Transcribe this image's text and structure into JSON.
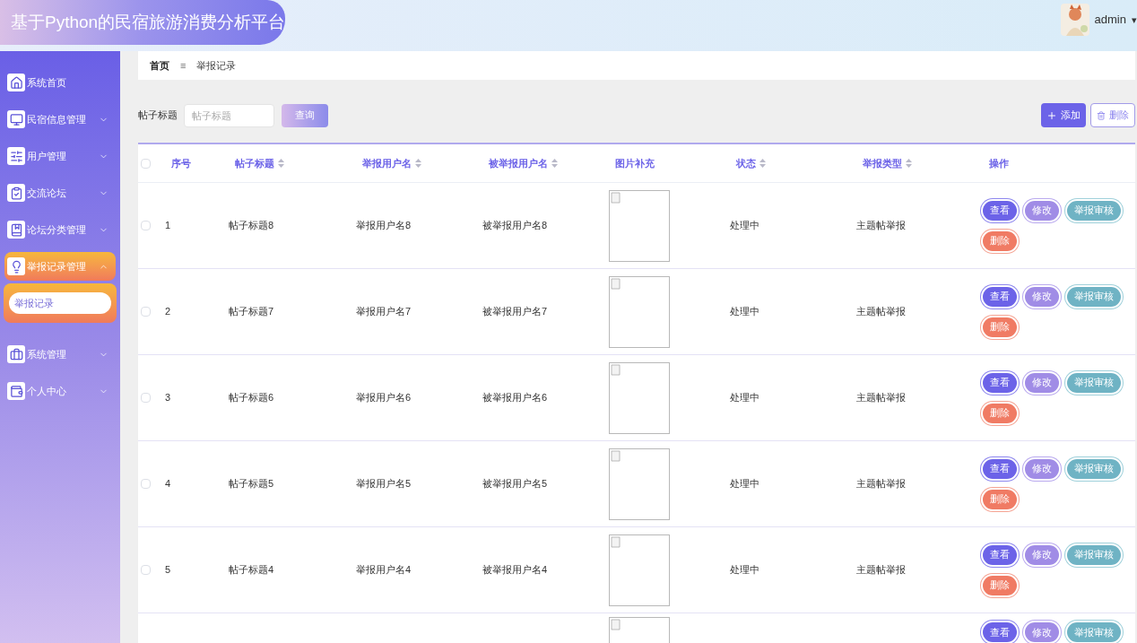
{
  "header": {
    "title": "基于Python的民宿旅游消费分析平台",
    "user": {
      "name": "admin",
      "caret": "▾"
    }
  },
  "sidebar": {
    "items": [
      {
        "label": "系统首页",
        "expandable": false,
        "selected": false
      },
      {
        "label": "民宿信息管理",
        "expandable": true,
        "expanded": false,
        "selected": false
      },
      {
        "label": "用户管理",
        "expandable": true,
        "expanded": false,
        "selected": false
      },
      {
        "label": "交流论坛",
        "expandable": true,
        "expanded": false,
        "selected": false
      },
      {
        "label": "论坛分类管理",
        "expandable": true,
        "expanded": false,
        "selected": false
      },
      {
        "label": "举报记录管理",
        "expandable": true,
        "expanded": true,
        "selected": true,
        "children": [
          {
            "label": "举报记录",
            "selected": true
          }
        ]
      },
      {
        "label": "系统管理",
        "expandable": true,
        "expanded": false,
        "selected": false
      },
      {
        "label": "个人中心",
        "expandable": true,
        "expanded": false,
        "selected": false
      }
    ]
  },
  "breadcrumb": {
    "home": "首页",
    "separator": "≡",
    "current": "举报记录"
  },
  "search": {
    "label": "帖子标题",
    "placeholder": "帖子标题",
    "button": "查询"
  },
  "toolbar": {
    "add": "添加",
    "delete": "删除"
  },
  "table": {
    "all_checked": false,
    "columns": [
      {
        "label": "序号",
        "sortable": false
      },
      {
        "label": "帖子标题",
        "sortable": true
      },
      {
        "label": "举报用户名",
        "sortable": true
      },
      {
        "label": "被举报用户名",
        "sortable": true
      },
      {
        "label": "图片补充",
        "sortable": false
      },
      {
        "label": "状态",
        "sortable": true
      },
      {
        "label": "举报类型",
        "sortable": true
      },
      {
        "label": "操作",
        "sortable": false
      }
    ],
    "rows": [
      {
        "checked": false,
        "cells": [
          "1",
          "帖子标题8",
          "举报用户名8",
          "被举报用户名8",
          "处理中",
          "主题帖举报"
        ],
        "image": {
          "kind": "broken-image"
        },
        "actions": [
          {
            "kind": "view",
            "label": "查看"
          },
          {
            "kind": "edit",
            "label": "修改"
          },
          {
            "kind": "audit",
            "label": "举报审核"
          },
          {
            "kind": "delete",
            "label": "删除"
          }
        ]
      },
      {
        "checked": false,
        "cells": [
          "2",
          "帖子标题7",
          "举报用户名7",
          "被举报用户名7",
          "处理中",
          "主题帖举报"
        ],
        "image": {
          "kind": "broken-image"
        },
        "actions": [
          {
            "kind": "view",
            "label": "查看"
          },
          {
            "kind": "edit",
            "label": "修改"
          },
          {
            "kind": "audit",
            "label": "举报审核"
          },
          {
            "kind": "delete",
            "label": "删除"
          }
        ]
      },
      {
        "checked": false,
        "cells": [
          "3",
          "帖子标题6",
          "举报用户名6",
          "被举报用户名6",
          "处理中",
          "主题帖举报"
        ],
        "image": {
          "kind": "broken-image"
        },
        "actions": [
          {
            "kind": "view",
            "label": "查看"
          },
          {
            "kind": "edit",
            "label": "修改"
          },
          {
            "kind": "audit",
            "label": "举报审核"
          },
          {
            "kind": "delete",
            "label": "删除"
          }
        ]
      },
      {
        "checked": false,
        "cells": [
          "4",
          "帖子标题5",
          "举报用户名5",
          "被举报用户名5",
          "处理中",
          "主题帖举报"
        ],
        "image": {
          "kind": "broken-image"
        },
        "actions": [
          {
            "kind": "view",
            "label": "查看"
          },
          {
            "kind": "edit",
            "label": "修改"
          },
          {
            "kind": "audit",
            "label": "举报审核"
          },
          {
            "kind": "delete",
            "label": "删除"
          }
        ]
      },
      {
        "checked": false,
        "cells": [
          "5",
          "帖子标题4",
          "举报用户名4",
          "被举报用户名4",
          "处理中",
          "主题帖举报"
        ],
        "image": {
          "kind": "broken-image"
        },
        "actions": [
          {
            "kind": "view",
            "label": "查看"
          },
          {
            "kind": "edit",
            "label": "修改"
          },
          {
            "kind": "audit",
            "label": "举报审核"
          },
          {
            "kind": "delete",
            "label": "删除"
          }
        ]
      },
      {
        "cut": true,
        "image": {
          "kind": "broken-image"
        },
        "actions": [
          {
            "kind": "view",
            "label": "查看"
          },
          {
            "kind": "edit",
            "label": "修改"
          },
          {
            "kind": "audit",
            "label": "举报审核"
          }
        ]
      }
    ]
  }
}
